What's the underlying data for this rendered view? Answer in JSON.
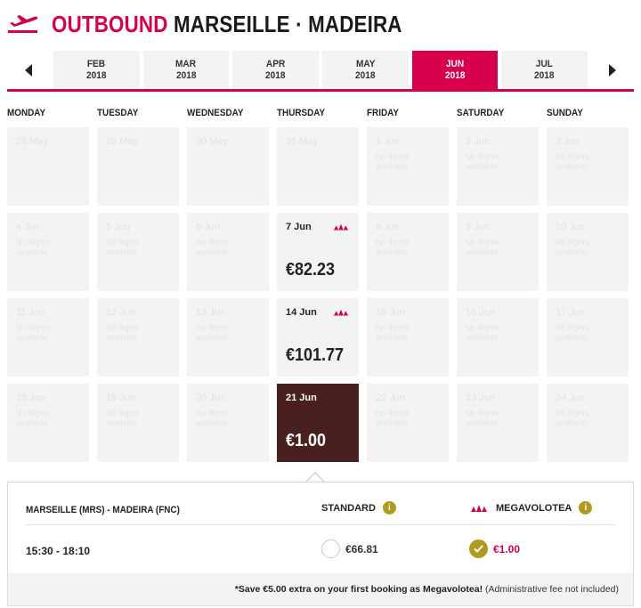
{
  "header": {
    "title_accent": "OUTBOUND",
    "title_route": "MARSEILLE · MADEIRA"
  },
  "months": [
    {
      "month": "FEB",
      "year": "2018",
      "active": false
    },
    {
      "month": "MAR",
      "year": "2018",
      "active": false
    },
    {
      "month": "APR",
      "year": "2018",
      "active": false
    },
    {
      "month": "MAY",
      "year": "2018",
      "active": false
    },
    {
      "month": "JUN",
      "year": "2018",
      "active": true
    },
    {
      "month": "JUL",
      "year": "2018",
      "active": false
    }
  ],
  "weekdays": [
    "MONDAY",
    "TUESDAY",
    "WEDNESDAY",
    "THURSDAY",
    "FRIDAY",
    "SATURDAY",
    "SUNDAY"
  ],
  "weeks": [
    [
      {
        "date": "28 May",
        "note": ""
      },
      {
        "date": "29 May",
        "note": ""
      },
      {
        "date": "30 May",
        "note": ""
      },
      {
        "date": "31 May",
        "note": ""
      },
      {
        "date": "1 Jun",
        "note": "No flights available"
      },
      {
        "date": "2 Jun",
        "note": "No flights available"
      },
      {
        "date": "3 Jun",
        "note": "No flights available"
      }
    ],
    [
      {
        "date": "4 Jun",
        "note": "No flights available"
      },
      {
        "date": "5 Jun",
        "note": "No flights available"
      },
      {
        "date": "6 Jun",
        "note": "No flights available"
      },
      {
        "date": "7 Jun",
        "price": "€82.23",
        "mega": true
      },
      {
        "date": "8 Jun",
        "note": "No flights available"
      },
      {
        "date": "9 Jun",
        "note": "No flights available"
      },
      {
        "date": "10 Jun",
        "note": "No flights available"
      }
    ],
    [
      {
        "date": "11 Jun",
        "note": "No flights available"
      },
      {
        "date": "12 Jun",
        "note": "No flights available"
      },
      {
        "date": "13 Jun",
        "note": "No flights available"
      },
      {
        "date": "14 Jun",
        "price": "€101.77",
        "mega": true
      },
      {
        "date": "15 Jun",
        "note": "No flights available"
      },
      {
        "date": "16 Jun",
        "note": "No flights available"
      },
      {
        "date": "17 Jun",
        "note": "No flights available"
      }
    ],
    [
      {
        "date": "18 Jun",
        "note": "No flights available"
      },
      {
        "date": "19 Jun",
        "note": "No flights available"
      },
      {
        "date": "20 Jun",
        "note": "No flights available"
      },
      {
        "date": "21 Jun",
        "price": "€1.00",
        "selected": true
      },
      {
        "date": "22 Jun",
        "note": "No flights available"
      },
      {
        "date": "23 Jun",
        "note": "No flights available"
      },
      {
        "date": "24 Jun",
        "note": "No flights available"
      }
    ]
  ],
  "panel": {
    "route": "MARSEILLE (MRS) - MADEIRA (FNC)",
    "standard_label": "STANDARD",
    "mega_label": "MEGAVOLOTEA",
    "info_glyph": "i",
    "time": "15:30 - 18:10",
    "standard_price": "€66.81",
    "mega_price": "€1.00",
    "footer_bold": "*Save €5.00 extra on your first booking as Megavolotea!",
    "footer_rest": " (Administrative fee not included)"
  },
  "colors": {
    "accent": "#d6004d",
    "selected_cell": "#4a1f1f",
    "gold": "#b09a1f"
  }
}
